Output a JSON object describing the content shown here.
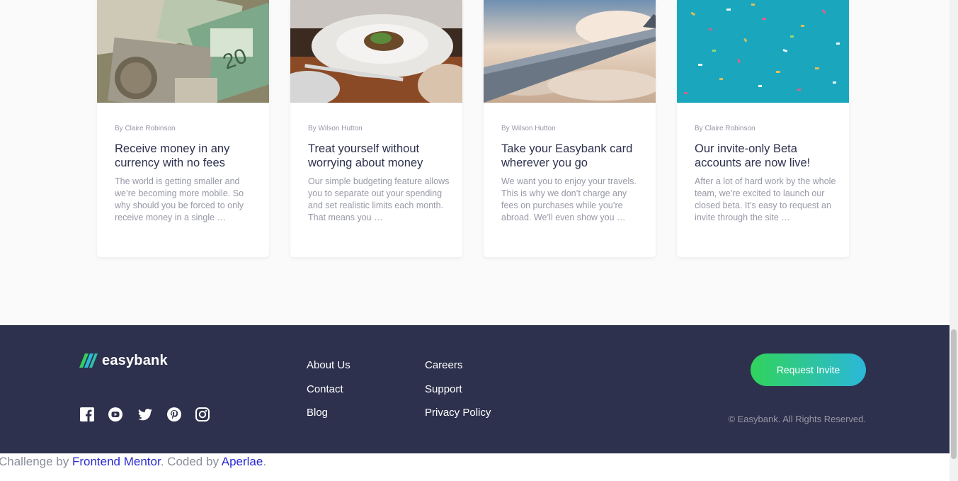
{
  "articles": [
    {
      "author": "By Claire Robinson",
      "title": "Receive money in any currency with no fees",
      "excerpt": "The world is getting smaller and we’re becoming more mobile. So why should you be forced to only receive money in a single …",
      "image": "currency-notes"
    },
    {
      "author": "By Wilson Hutton",
      "title": "Treat yourself without worrying about money",
      "excerpt": "Our simple budgeting feature allows you to separate out your spending and set realistic limits each month. That means you …",
      "image": "restaurant-plate"
    },
    {
      "author": "By Wilson Hutton",
      "title": "Take your Easybank card wherever you go",
      "excerpt": "We want you to enjoy your travels. This is why we don’t charge any fees on purchases while you’re abroad. We’ll even show you …",
      "image": "airplane-wing"
    },
    {
      "author": "By Claire Robinson",
      "title": "Our invite-only Beta accounts are now live!",
      "excerpt": "After a lot of hard work by the whole team, we’re excited to launch our closed beta. It’s easy to request an invite through the site …",
      "image": "confetti"
    }
  ],
  "footer": {
    "logo_text": "easybank",
    "social_icons": [
      "facebook-icon",
      "youtube-icon",
      "twitter-icon",
      "pinterest-icon",
      "instagram-icon"
    ],
    "links_col1": [
      "About Us",
      "Contact",
      "Blog"
    ],
    "links_col2": [
      "Careers",
      "Support",
      "Privacy Policy"
    ],
    "cta_label": "Request Invite",
    "copyright": "© Easybank. All Rights Reserved."
  },
  "attribution": {
    "prefix": "Challenge by ",
    "link1": "Frontend Mentor",
    "middle": ". Coded by ",
    "link2": "Aperlae",
    "suffix": "."
  },
  "colors": {
    "footer_bg": "#2d314d",
    "cta_start": "#31d35c",
    "cta_end": "#2bb7da",
    "title_text": "#2d314d",
    "muted_text": "#9698a6"
  }
}
